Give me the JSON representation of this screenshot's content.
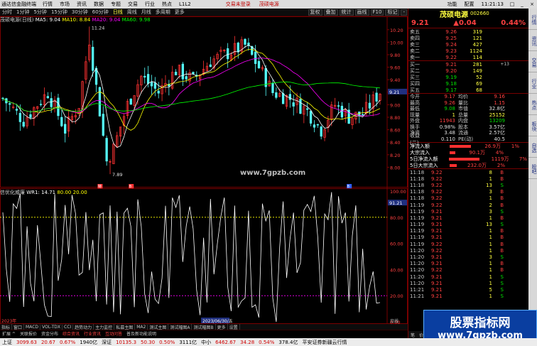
{
  "menubar": {
    "app_title": "通达信金融终端",
    "items": [
      "行情",
      "市场",
      "资讯",
      "数据",
      "专题",
      "交易",
      "行业",
      "热点",
      "L1L2"
    ],
    "notice_1": "交易未登录",
    "notice_2": "茂硕电源",
    "right_items": [
      "功能",
      "配置"
    ],
    "time": "11:21:13",
    "win_buttons": [
      "□",
      "_",
      "×"
    ]
  },
  "toolbar": {
    "periods": [
      "分时",
      "1分钟",
      "5分钟",
      "15分钟",
      "30分钟",
      "60分钟",
      "日线",
      "周线",
      "月线",
      "多周期",
      "更多"
    ],
    "active_period": "日线",
    "right_buttons": [
      "复权",
      "叠加",
      "统计",
      "画线",
      "F10",
      "标记",
      "-"
    ]
  },
  "chart": {
    "stock_label": "茂硕电源(日线)",
    "ma5": "MA5: 9.04",
    "ma10": "MA10: 8.84",
    "ma20": "MA20: 9.04",
    "ma60": "MA60: 9.98",
    "high_label": "11.24",
    "low_label": "7.89",
    "watermark": "www.7gpzb.com",
    "ind_name": "信优化威廉",
    "ind_wr": "WR1: 14.71",
    "ind_lv1": "80.00",
    "ind_lv2": "20.00",
    "price_axis": [
      "10.20",
      "10.00",
      "9.80",
      "9.60",
      "9.40",
      "9.20",
      "9.00",
      "8.80",
      "8.60",
      "8.40",
      "8.20",
      "8.00"
    ],
    "ind_axis": [
      "100.00",
      "80.00",
      "60.00",
      "40.00",
      "20.00",
      "0.00"
    ],
    "cur_price_tag": "9.21",
    "cur_ind_tag": "91.21",
    "date_left": "2023年",
    "date_mid": "2023/06/30/五",
    "date_right": "日线",
    "markers": [
      "特",
      "B",
      "B"
    ]
  },
  "bottom_tabs": [
    "指标",
    "窗口",
    "MACD",
    "VOL-TDX",
    "CCI",
    "趋势动力",
    "主力监控",
    "私募主图",
    "MA2",
    "测试主图",
    "测试幅图A",
    "测试幅图B",
    "更多",
    "设置"
  ],
  "info_strip": [
    "扩展 ^",
    "关联报价",
    "资金分布",
    "综合资讯",
    "行业资讯",
    "互动问答",
    "普及新功能说明"
  ],
  "ticker": {
    "items": [
      {
        "label": "上证",
        "value": "3099.63",
        "chg": "20.67",
        "pct": "0.67%",
        "amt": "1940亿"
      },
      {
        "label": "深证",
        "value": "10135.3",
        "chg": "50.30",
        "pct": "0.50%",
        "amt": "3111亿"
      },
      {
        "label": "中小",
        "value": "6462.67",
        "chg": "34.28",
        "pct": "0.54%",
        "amt": "378.4亿"
      }
    ],
    "tail": "平安证券新疆云行情"
  },
  "quote": {
    "name": "茂硕电源",
    "code": "002660",
    "price": "9.21",
    "change": "▲0.04",
    "pct": "0.44%",
    "sells": [
      {
        "label": "卖五",
        "price": "9.26",
        "vol": "319"
      },
      {
        "label": "卖四",
        "price": "9.25",
        "vol": "121"
      },
      {
        "label": "卖三",
        "price": "9.24",
        "vol": "427"
      },
      {
        "label": "卖二",
        "price": "9.23",
        "vol": "1124"
      },
      {
        "label": "卖一",
        "price": "9.22",
        "vol": "114"
      }
    ],
    "buys": [
      {
        "label": "买一",
        "price": "9.21",
        "vol": "281",
        "extra": "+13"
      },
      {
        "label": "买二",
        "price": "9.20",
        "vol": "149",
        "extra": ""
      },
      {
        "label": "买三",
        "price": "9.19",
        "vol": "52",
        "extra": ""
      },
      {
        "label": "买四",
        "price": "9.18",
        "vol": "69",
        "extra": ""
      },
      {
        "label": "买五",
        "price": "9.17",
        "vol": "68",
        "extra": ""
      }
    ],
    "stats": [
      {
        "a": "今开",
        "b": "9.17",
        "c": "均价",
        "d": "9.16",
        "bc": "red",
        "dc": "red"
      },
      {
        "a": "最高",
        "b": "9.26",
        "c": "量比",
        "d": "1.15",
        "bc": "red",
        "dc": "red"
      },
      {
        "a": "最低",
        "b": "9.08",
        "c": "市值",
        "d": "32.8亿",
        "bc": "grn",
        "dc": "wht"
      },
      {
        "a": "现量",
        "b": "1",
        "c": "总量",
        "d": "25152",
        "bc": "ylw",
        "dc": "ylw"
      },
      {
        "a": "外盘",
        "b": "11943",
        "c": "内盘",
        "d": "13209",
        "bc": "red",
        "dc": "grn"
      },
      {
        "a": "换手",
        "b": "0.98%",
        "c": "股本",
        "d": "3.57亿",
        "bc": "wht",
        "dc": "wht"
      },
      {
        "a": "净资",
        "b": "3.48",
        "c": "流通",
        "d": "2.57亿",
        "bc": "wht",
        "dc": "wht"
      },
      {
        "a": "收益(二)",
        "b": "0.110",
        "c": "PE(动)",
        "d": "40.5",
        "bc": "wht",
        "dc": "wht"
      }
    ],
    "flows": [
      {
        "a": "净流入额",
        "b": "26.9万",
        "c": "1%",
        "w": 30
      },
      {
        "a": "大宗流入",
        "b": "90.1万",
        "c": "4%",
        "w": 8
      },
      {
        "a": "5日净流入额",
        "b": "1119万",
        "c": "7%",
        "w": 44
      },
      {
        "a": "5日大宗流入",
        "b": "232.0万",
        "c": "2%",
        "w": 10
      }
    ],
    "ticks": [
      {
        "t": "11:18",
        "p": "9.22",
        "v": "8",
        "s": "B"
      },
      {
        "t": "11:18",
        "p": "9.22",
        "v": "1",
        "s": "B"
      },
      {
        "t": "11:18",
        "p": "9.22",
        "v": "13",
        "s": "S"
      },
      {
        "t": "11:18",
        "p": "9.22",
        "v": "3",
        "s": "B"
      },
      {
        "t": "11:18",
        "p": "9.22",
        "v": "1",
        "s": "B"
      },
      {
        "t": "11:19",
        "p": "9.22",
        "v": "2",
        "s": "B"
      },
      {
        "t": "11:19",
        "p": "9.21",
        "v": "3",
        "s": "S"
      },
      {
        "t": "11:19",
        "p": "9.21",
        "v": "1",
        "s": "B"
      },
      {
        "t": "11:19",
        "p": "9.21",
        "v": "13",
        "s": "S"
      },
      {
        "t": "11:19",
        "p": "9.21",
        "v": "1",
        "s": "B"
      },
      {
        "t": "11:19",
        "p": "9.21",
        "v": "1",
        "s": "B"
      },
      {
        "t": "11:19",
        "p": "9.22",
        "v": "1",
        "s": "B"
      },
      {
        "t": "11:20",
        "p": "9.22",
        "v": "1",
        "s": "B"
      },
      {
        "t": "11:20",
        "p": "9.21",
        "v": "3",
        "s": "S"
      },
      {
        "t": "11:20",
        "p": "9.21",
        "v": "1",
        "s": "B"
      },
      {
        "t": "11:20",
        "p": "9.22",
        "v": "1",
        "s": "B"
      },
      {
        "t": "11:20",
        "p": "9.21",
        "v": "1",
        "s": "S"
      },
      {
        "t": "11:20",
        "p": "9.21",
        "v": "1",
        "s": "S"
      },
      {
        "t": "11:21",
        "p": "9.21",
        "v": "5",
        "s": "S"
      },
      {
        "t": "11:21",
        "p": "9.21",
        "v": "1",
        "s": "S"
      }
    ],
    "tabs": [
      "笔",
      "价",
      "细",
      "势",
      "联",
      "值",
      "主",
      "筹",
      "副"
    ]
  },
  "sidebar": [
    "行情",
    "资讯",
    "交易",
    "行业",
    "热点",
    "板块",
    "自选",
    "股吧"
  ],
  "brand": {
    "line1": "股票指标网",
    "line2": "www.7gpzb.com"
  },
  "colors": {
    "up": "#ff3232",
    "down": "#54fcfc",
    "ma5": "#ffffff",
    "ma10": "#ffff00",
    "ma20": "#ff00ff",
    "ma60": "#00ff00",
    "grid_red": "#7a0000"
  }
}
